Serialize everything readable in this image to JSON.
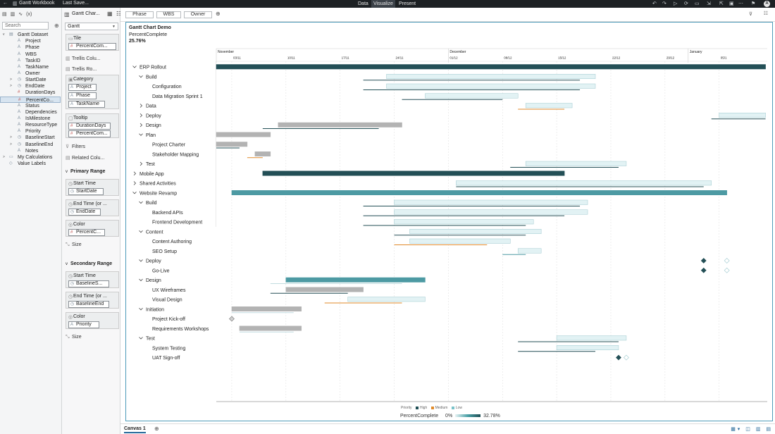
{
  "app": {
    "workbook_title": "Gantt Workbook",
    "save_status": "Last Save...",
    "modes": [
      "Data",
      "Visualize",
      "Present"
    ],
    "active_mode": "Visualize",
    "avatar_initial": "A"
  },
  "data_pane": {
    "search_placeholder": "Search",
    "dataset": "Gantt Dataset",
    "fields": [
      {
        "name": "Project",
        "type": "A",
        "caret": false
      },
      {
        "name": "Phase",
        "type": "A",
        "caret": false
      },
      {
        "name": "WBS",
        "type": "A",
        "caret": false
      },
      {
        "name": "TaskID",
        "type": "A",
        "caret": false
      },
      {
        "name": "TaskName",
        "type": "A",
        "caret": false
      },
      {
        "name": "Owner",
        "type": "A",
        "caret": false
      },
      {
        "name": "StartDate",
        "type": "◷",
        "caret": true
      },
      {
        "name": "EndDate",
        "type": "◷",
        "caret": true
      },
      {
        "name": "DurationDays",
        "type": "#",
        "caret": false
      },
      {
        "name": "PercentCo...",
        "type": "#",
        "caret": false,
        "selected": true
      },
      {
        "name": "Status",
        "type": "A",
        "caret": false
      },
      {
        "name": "Dependencies",
        "type": "A",
        "caret": false
      },
      {
        "name": "IsMilestone",
        "type": "A",
        "caret": false
      },
      {
        "name": "ResourceType",
        "type": "A",
        "caret": false
      },
      {
        "name": "Priority",
        "type": "A",
        "caret": false
      },
      {
        "name": "BaselineStart",
        "type": "◷",
        "caret": true
      },
      {
        "name": "BaselineEnd",
        "type": "◷",
        "caret": true
      },
      {
        "name": "Notes",
        "type": "A",
        "caret": false
      }
    ],
    "my_calculations": "My Calculations",
    "value_labels": "Value Labels"
  },
  "grammar": {
    "header": "Gantt Char...",
    "viz_type": "Gantt",
    "tile_label": "Tile",
    "tile_field": "PercentCom...",
    "trellis_columns": "Trellis Colu...",
    "trellis_rows": "Trellis Ro...",
    "category_label": "Category",
    "category_fields": [
      "Project",
      "Phase",
      "TaskName"
    ],
    "tooltip_label": "Tooltip",
    "tooltip_fields": [
      "DurationDays",
      "PercentCom..."
    ],
    "filters": "Filters",
    "related_columns": "Related Colu...",
    "primary_range": "Primary Range",
    "start_time": "Start Time",
    "primary_start": "StartDate",
    "end_time": "End Time (or ...",
    "primary_end": "EndDate",
    "color": "Color",
    "primary_color": "PercentC...",
    "size": "Size",
    "secondary_range": "Secondary Range",
    "secondary_start": "BaselineS...",
    "end_time_2": "End Time (or ...",
    "secondary_end": "BaselineEnd",
    "secondary_color": "Priority"
  },
  "filter_chips": [
    "Phase",
    "WBS",
    "Owner"
  ],
  "viz": {
    "title": "Gantt Chart Demo",
    "subtitle": "PercentComplete",
    "value": "25.76%",
    "months": [
      {
        "label": "November",
        "day": 0
      },
      {
        "label": "December",
        "day": 30
      },
      {
        "label": "January",
        "day": 61
      }
    ],
    "week_ticks": [
      {
        "label": "03/11",
        "day": 2
      },
      {
        "label": "10/11",
        "day": 9
      },
      {
        "label": "17/11",
        "day": 16
      },
      {
        "label": "24/11",
        "day": 23
      },
      {
        "label": "01/12",
        "day": 30
      },
      {
        "label": "08/12",
        "day": 37
      },
      {
        "label": "15/12",
        "day": 44
      },
      {
        "label": "22/12",
        "day": 51
      },
      {
        "label": "29/12",
        "day": 58
      },
      {
        "label": "05/1",
        "day": 65
      }
    ],
    "rows": [
      {
        "label": "ERP Rollout",
        "level": 0,
        "chev": "v",
        "primary": [
          0,
          71
        ],
        "color": "dark"
      },
      {
        "label": "Build",
        "level": 1,
        "chev": "v",
        "primary": [
          22,
          49
        ],
        "color": "light",
        "baseline": [
          19,
          47
        ],
        "baseline_color": "dark"
      },
      {
        "label": "Configuration",
        "level": 2,
        "primary": [
          22,
          49
        ],
        "color": "light",
        "baseline": [
          19,
          47
        ],
        "baseline_color": "dark"
      },
      {
        "label": "Data Migration Sprint 1",
        "level": 2,
        "primary": [
          27,
          39
        ],
        "color": "light",
        "baseline": [
          24,
          37
        ],
        "baseline_color": "dark"
      },
      {
        "label": "Data",
        "level": 1,
        "chev": ">",
        "primary": [
          40,
          46
        ],
        "color": "light",
        "baseline": [
          39,
          45
        ],
        "baseline_color": "orange"
      },
      {
        "label": "Deploy",
        "level": 1,
        "chev": ">",
        "primary": [
          65,
          71
        ],
        "color": "light",
        "baseline": [
          64,
          71
        ],
        "baseline_color": "dark"
      },
      {
        "label": "Design",
        "level": 1,
        "chev": ">",
        "primary": [
          8,
          24
        ],
        "color": "gray",
        "baseline": [
          6,
          21
        ],
        "baseline_color": "dark"
      },
      {
        "label": "Plan",
        "level": 1,
        "chev": "v",
        "primary": [
          0,
          7
        ],
        "color": "gray"
      },
      {
        "label": "Project Charter",
        "level": 2,
        "primary": [
          0,
          4
        ],
        "color": "gray",
        "baseline": [
          0,
          3
        ],
        "baseline_color": "dark"
      },
      {
        "label": "Stakeholder Mapping",
        "level": 2,
        "primary": [
          5,
          7
        ],
        "color": "gray",
        "baseline": [
          4,
          6
        ],
        "baseline_color": "orange"
      },
      {
        "label": "Test",
        "level": 1,
        "chev": ">",
        "primary": [
          40,
          53
        ],
        "color": "light",
        "baseline": [
          38,
          52
        ],
        "baseline_color": "dark"
      },
      {
        "label": "Mobile App",
        "level": 0,
        "chev": ">",
        "primary": [
          6,
          45
        ],
        "color": "dark"
      },
      {
        "label": "Shared Activities",
        "level": 0,
        "chev": ">",
        "primary": [
          31,
          64
        ],
        "color": "light",
        "baseline": [
          31,
          63
        ],
        "baseline_color": "dark"
      },
      {
        "label": "Website Revamp",
        "level": 0,
        "chev": "v",
        "primary": [
          2,
          66
        ],
        "color": "teal"
      },
      {
        "label": "Build",
        "level": 1,
        "chev": "v",
        "primary": [
          23,
          48
        ],
        "color": "light",
        "baseline": [
          19,
          47
        ],
        "baseline_color": "dark"
      },
      {
        "label": "Backend APIs",
        "level": 2,
        "primary": [
          23,
          48
        ],
        "color": "light",
        "baseline": [
          19,
          45
        ],
        "baseline_color": "dark"
      },
      {
        "label": "Frontend Development",
        "level": 2,
        "primary": [
          23,
          41
        ],
        "color": "light",
        "baseline": [
          19,
          40
        ],
        "baseline_color": "dark"
      },
      {
        "label": "Content",
        "level": 1,
        "chev": "v",
        "primary": [
          25,
          42
        ],
        "color": "light",
        "baseline": [
          23,
          40
        ],
        "baseline_color": "dark"
      },
      {
        "label": "Content Authoring",
        "level": 2,
        "primary": [
          25,
          38
        ],
        "color": "light",
        "baseline": [
          23,
          35
        ],
        "baseline_color": "orange"
      },
      {
        "label": "SEO Setup",
        "level": 2,
        "primary": [
          39,
          42
        ],
        "color": "light",
        "baseline": [
          37,
          40
        ],
        "baseline_color": "teal"
      },
      {
        "label": "Deploy",
        "level": 1,
        "chev": "v",
        "milestone": 63,
        "ghost_milestone": 66
      },
      {
        "label": "Go-Live",
        "level": 2,
        "milestone": 63,
        "ghost_milestone": 66
      },
      {
        "label": "Design",
        "level": 1,
        "chev": "v",
        "primary": [
          9,
          27
        ],
        "color": "teal",
        "baseline": [
          7,
          24
        ],
        "baseline_color": "light"
      },
      {
        "label": "UX Wireframes",
        "level": 2,
        "primary": [
          9,
          19
        ],
        "color": "gray",
        "baseline": [
          7,
          17
        ],
        "baseline_color": "dark"
      },
      {
        "label": "Visual Design",
        "level": 2,
        "primary": [
          17,
          27
        ],
        "color": "light",
        "baseline": [
          14,
          24
        ],
        "baseline_color": "orange"
      },
      {
        "label": "Initiation",
        "level": 1,
        "chev": "v",
        "primary": [
          2,
          11
        ],
        "color": "gray",
        "baseline": [
          2,
          10
        ],
        "baseline_color": "light"
      },
      {
        "label": "Project Kick-off",
        "level": 2,
        "milestone": 2,
        "milestone_style": "gray"
      },
      {
        "label": "Requirements Workshops",
        "level": 2,
        "primary": [
          3,
          11
        ],
        "color": "gray",
        "baseline": [
          3,
          10
        ],
        "baseline_color": "light"
      },
      {
        "label": "Test",
        "level": 1,
        "chev": "v",
        "primary": [
          44,
          53
        ],
        "color": "light",
        "baseline": [
          39,
          52
        ],
        "baseline_color": "dark"
      },
      {
        "label": "System Testing",
        "level": 2,
        "primary": [
          44,
          52
        ],
        "color": "light",
        "baseline": [
          39,
          49
        ],
        "baseline_color": "dark"
      },
      {
        "label": "UAT Sign-off",
        "level": 2,
        "milestone": 52,
        "ghost_milestone": 53
      }
    ],
    "legend": {
      "title": "Priority",
      "items": [
        {
          "label": "High",
          "color": "#1f4e55"
        },
        {
          "label": "Medium",
          "color": "#e08a2a"
        },
        {
          "label": "Low",
          "color": "#7ac2c9"
        }
      ],
      "scale_label": "PercentComplete",
      "scale_min": "0%",
      "scale_max": "32.78%"
    }
  },
  "canvas_tab": "Canvas 1",
  "colors": {
    "dark": "#234f56",
    "teal": "#4d9aa3",
    "light": "#e2f2f4",
    "gray": "#b3b3b3",
    "orange": "#e08a2a",
    "frame": "#4d9bb8"
  }
}
